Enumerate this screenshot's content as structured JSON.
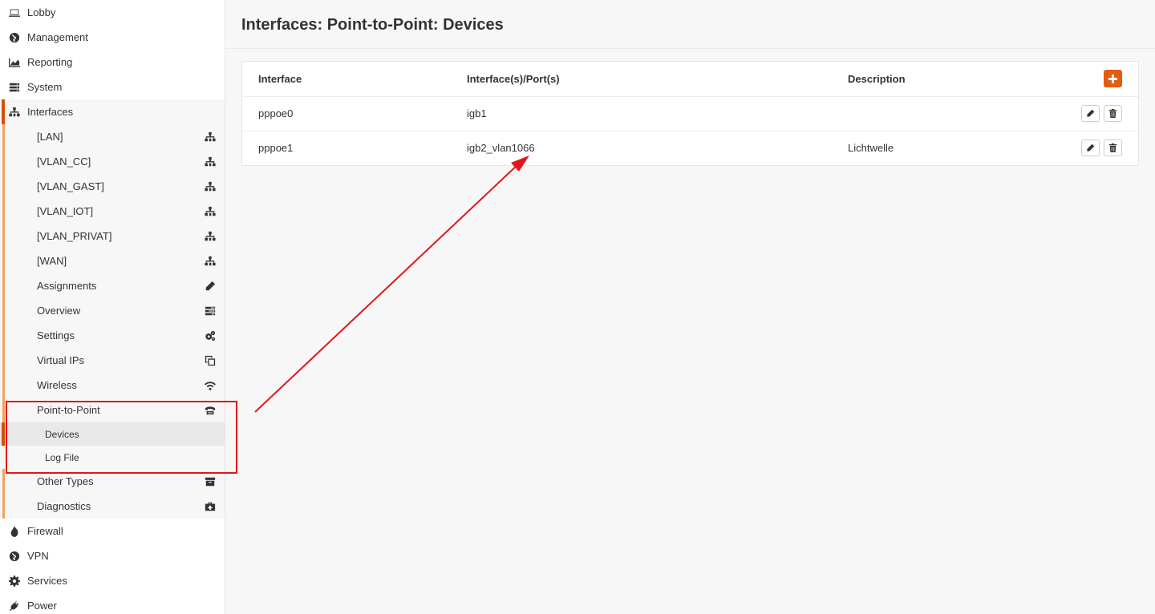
{
  "sidebar": {
    "lobby": "Lobby",
    "management": "Management",
    "reporting": "Reporting",
    "system": "System",
    "interfaces": "Interfaces",
    "interfaces_items": {
      "lan": "[LAN]",
      "vlan_cc": "[VLAN_CC]",
      "vlan_gast": "[VLAN_GAST]",
      "vlan_iot": "[VLAN_IOT]",
      "vlan_privat": "[VLAN_PRIVAT]",
      "wan": "[WAN]",
      "assignments": "Assignments",
      "overview": "Overview",
      "settings": "Settings",
      "virtual_ips": "Virtual IPs",
      "wireless": "Wireless",
      "point_to_point": "Point-to-Point",
      "devices": "Devices",
      "log_file": "Log File",
      "other_types": "Other Types",
      "diagnostics": "Diagnostics"
    },
    "firewall": "Firewall",
    "vpn": "VPN",
    "services": "Services",
    "power": "Power",
    "active_item": "Devices"
  },
  "main": {
    "title": "Interfaces: Point-to-Point: Devices",
    "table": {
      "headers": {
        "interface": "Interface",
        "ports": "Interface(s)/Port(s)",
        "description": "Description"
      },
      "rows": [
        {
          "interface": "pppoe0",
          "ports": "igb1",
          "description": ""
        },
        {
          "interface": "pppoe1",
          "ports": "igb2_vlan1066",
          "description": "Lichtwelle"
        }
      ]
    }
  },
  "colors": {
    "accent": "#e25d0f",
    "annotation": "#e0161b"
  }
}
